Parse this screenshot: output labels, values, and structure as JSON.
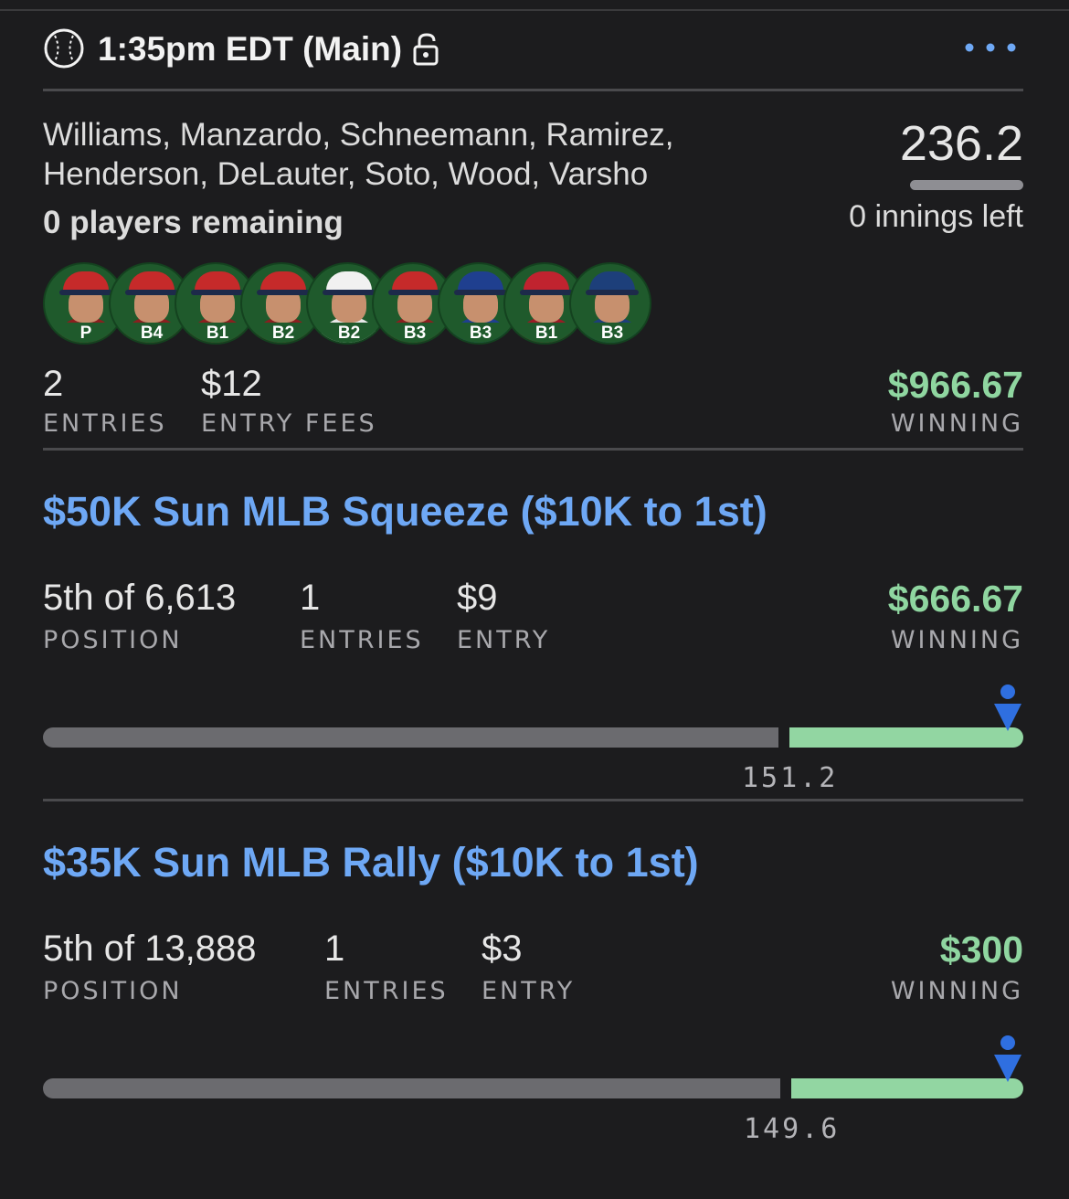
{
  "header": {
    "slate_title": "1:35pm EDT (Main)",
    "icons": {
      "sport": "baseball-icon",
      "lock": "unlock-icon",
      "menu": "more-dots-icon"
    }
  },
  "lineup": {
    "names": "Williams, Manzardo, Schneemann, Ramirez, Henderson, DeLauter, Soto, Wood, Varsho",
    "players_remaining": "0 players remaining",
    "score": "236.2",
    "innings_left": "0 innings left",
    "players": [
      {
        "position": "P",
        "cap_color": "#c62a2a",
        "jersey_color": "#8a1f1f"
      },
      {
        "position": "B4",
        "cap_color": "#c62a2a",
        "jersey_color": "#8a1f1f"
      },
      {
        "position": "B1",
        "cap_color": "#c62a2a",
        "jersey_color": "#8a1f1f"
      },
      {
        "position": "B2",
        "cap_color": "#c62a2a",
        "jersey_color": "#8a1f1f"
      },
      {
        "position": "B2",
        "cap_color": "#f1f1f1",
        "jersey_color": "#e8e8e8"
      },
      {
        "position": "B3",
        "cap_color": "#c62a2a",
        "jersey_color": "#8a1f1f"
      },
      {
        "position": "B3",
        "cap_color": "#1f3f8f",
        "jersey_color": "#1f3f8f"
      },
      {
        "position": "B1",
        "cap_color": "#c0232f",
        "jersey_color": "#9a1b25"
      },
      {
        "position": "B3",
        "cap_color": "#1d3f7a",
        "jersey_color": "#1d3f7a"
      }
    ]
  },
  "summary": {
    "entries_value": "2",
    "entries_label": "ENTRIES",
    "fees_value": "$12",
    "fees_label": "ENTRY FEES",
    "winning_value": "$966.67",
    "winning_label": "WINNING"
  },
  "contests": [
    {
      "title": "$50K Sun MLB Squeeze ($10K to 1st)",
      "position_value": "5th of 6,613",
      "position_label": "POSITION",
      "entries_value": "1",
      "entries_label": "ENTRIES",
      "entry_value": "$9",
      "entry_label": "ENTRY",
      "winning_value": "$666.67",
      "winning_label": "WINNING",
      "cash_line_score": "151.2",
      "cash_line_fraction": 0.75
    },
    {
      "title": "$35K Sun MLB Rally ($10K to 1st)",
      "position_value": "5th of 13,888",
      "position_label": "POSITION",
      "entries_value": "1",
      "entries_label": "ENTRIES",
      "entry_value": "$3",
      "entry_label": "ENTRY",
      "winning_value": "$300",
      "winning_label": "WINNING",
      "cash_line_score": "149.6",
      "cash_line_fraction": 0.752
    }
  ],
  "colors": {
    "background": "#1c1c1e",
    "accent_blue": "#6ea8f5",
    "winning_green": "#8fd6a0",
    "user_marker": "#2f6fe0"
  }
}
